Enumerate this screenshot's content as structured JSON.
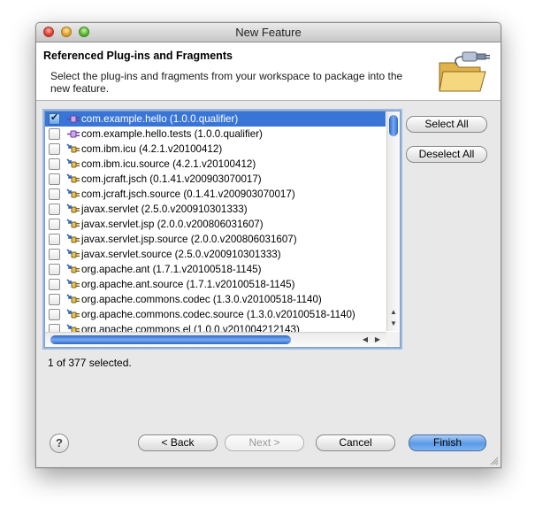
{
  "window": {
    "title": "New Feature"
  },
  "header": {
    "title": "Referenced Plug-ins and Fragments",
    "description": "Select the plug-ins and fragments from your workspace to package into the new feature.",
    "icon": "folder-plug-icon"
  },
  "list": {
    "items": [
      {
        "label": "com.example.hello (1.0.0.qualifier)",
        "checked": true,
        "selected": true,
        "icon": "workspace-plugin-icon"
      },
      {
        "label": "com.example.hello.tests (1.0.0.qualifier)",
        "checked": false,
        "selected": false,
        "icon": "workspace-plugin-icon"
      },
      {
        "label": "com.ibm.icu (4.2.1.v20100412)",
        "checked": false,
        "selected": false,
        "icon": "external-plugin-icon"
      },
      {
        "label": "com.ibm.icu.source (4.2.1.v20100412)",
        "checked": false,
        "selected": false,
        "icon": "external-plugin-icon"
      },
      {
        "label": "com.jcraft.jsch (0.1.41.v200903070017)",
        "checked": false,
        "selected": false,
        "icon": "external-plugin-icon"
      },
      {
        "label": "com.jcraft.jsch.source (0.1.41.v200903070017)",
        "checked": false,
        "selected": false,
        "icon": "external-plugin-icon"
      },
      {
        "label": "javax.servlet (2.5.0.v200910301333)",
        "checked": false,
        "selected": false,
        "icon": "external-plugin-icon"
      },
      {
        "label": "javax.servlet.jsp (2.0.0.v200806031607)",
        "checked": false,
        "selected": false,
        "icon": "external-plugin-icon"
      },
      {
        "label": "javax.servlet.jsp.source (2.0.0.v200806031607)",
        "checked": false,
        "selected": false,
        "icon": "external-plugin-icon"
      },
      {
        "label": "javax.servlet.source (2.5.0.v200910301333)",
        "checked": false,
        "selected": false,
        "icon": "external-plugin-icon"
      },
      {
        "label": "org.apache.ant (1.7.1.v20100518-1145)",
        "checked": false,
        "selected": false,
        "icon": "external-plugin-icon"
      },
      {
        "label": "org.apache.ant.source (1.7.1.v20100518-1145)",
        "checked": false,
        "selected": false,
        "icon": "external-plugin-icon"
      },
      {
        "label": "org.apache.commons.codec (1.3.0.v20100518-1140)",
        "checked": false,
        "selected": false,
        "icon": "external-plugin-icon"
      },
      {
        "label": "org.apache.commons.codec.source (1.3.0.v20100518-1140)",
        "checked": false,
        "selected": false,
        "icon": "external-plugin-icon"
      },
      {
        "label": "org.apache.commons.el (1.0.0.v201004212143)",
        "checked": false,
        "selected": false,
        "icon": "external-plugin-icon"
      }
    ],
    "selection_status": "1 of 377 selected."
  },
  "side_buttons": {
    "select_all": "Select All",
    "deselect_all": "Deselect All"
  },
  "footer": {
    "help": "?",
    "back": "< Back",
    "next": "Next >",
    "cancel": "Cancel",
    "finish": "Finish"
  },
  "colors": {
    "selection": "#3875d7",
    "accent": "#5b9ae6",
    "list_border": "#7f9db9"
  }
}
